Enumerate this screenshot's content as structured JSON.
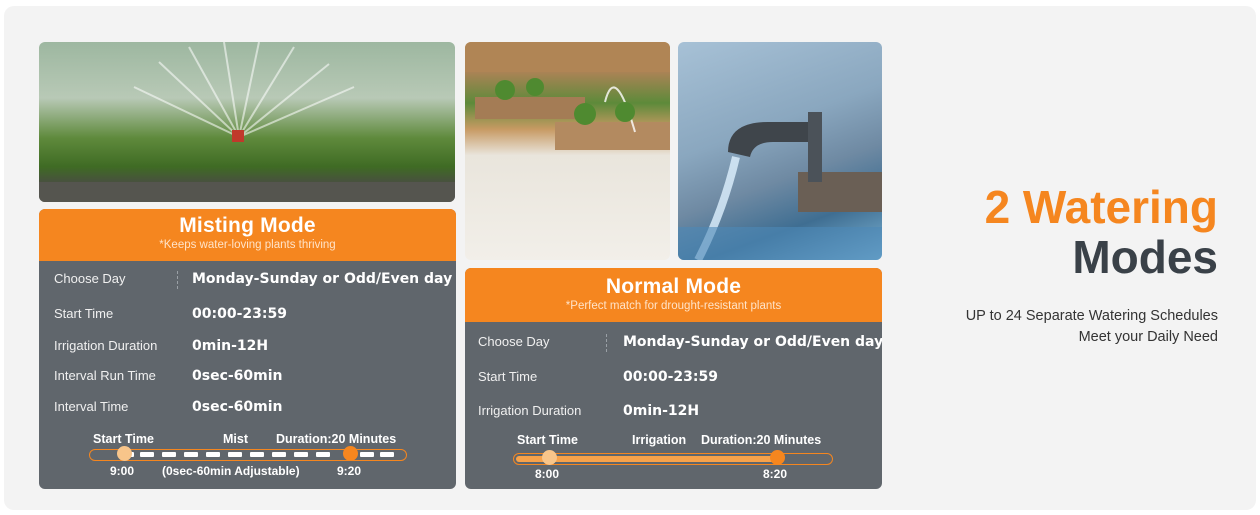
{
  "colors": {
    "accent": "#f5861f",
    "card_bg": "#60666c",
    "heading_dark": "#3a4148",
    "stage_bg": "#f3f3f3"
  },
  "images": [
    {
      "name": "sprinkler-lawn-photo"
    },
    {
      "name": "raised-garden-beds-photo"
    },
    {
      "name": "faucet-pool-photo"
    }
  ],
  "misting": {
    "title": "Misting Mode",
    "subtitle": "*Keeps water-loving plants thriving",
    "rows": [
      {
        "label": "Choose Day",
        "value": "Monday-Sunday or Odd/Even day"
      },
      {
        "label": "Start Time",
        "value": "00:00-23:59"
      },
      {
        "label": "Irrigation Duration",
        "value": "0min-12H"
      },
      {
        "label": "Interval Run Time",
        "value": "0sec-60min"
      },
      {
        "label": "Interval Time",
        "value": "0sec-60min"
      }
    ],
    "timeline": {
      "start_label": "Start Time",
      "middle_label": "Mist",
      "duration_label": "Duration:20 Minutes",
      "start_time": "9:00",
      "note": "(0sec-60min Adjustable)",
      "end_time": "9:20"
    }
  },
  "normal": {
    "title": "Normal Mode",
    "subtitle": "*Perfect match for drought-resistant plants",
    "rows": [
      {
        "label": "Choose Day",
        "value": "Monday-Sunday or Odd/Even day"
      },
      {
        "label": "Start Time",
        "value": "00:00-23:59"
      },
      {
        "label": "Irrigation Duration",
        "value": "0min-12H"
      }
    ],
    "timeline": {
      "start_label": "Start Time",
      "middle_label": "Irrigation",
      "duration_label": "Duration:20 Minutes",
      "start_time": "8:00",
      "end_time": "8:20"
    }
  },
  "heading": {
    "line1": "2 Watering",
    "line2": "Modes",
    "tagline_line1": "UP to 24 Separate Watering Schedules",
    "tagline_line2": "Meet your Daily Need"
  }
}
